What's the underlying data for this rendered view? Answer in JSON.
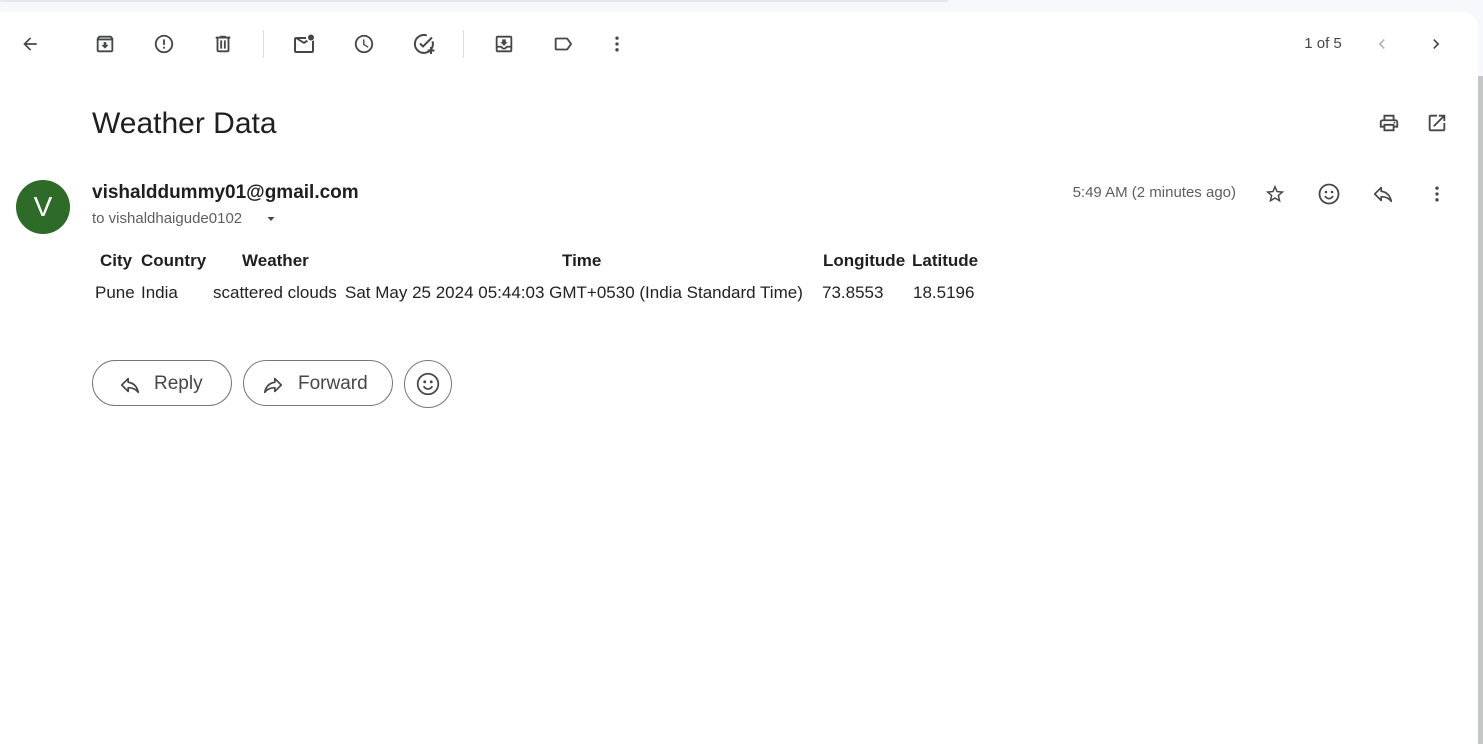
{
  "toolbar": {
    "counter": "1 of 5",
    "icons": {
      "back": "arrow-left-icon",
      "archive": "archive-icon",
      "spam": "report-spam-icon",
      "delete": "trash-icon",
      "mark_unread": "mark-unread-icon",
      "snooze": "clock-icon",
      "add_task": "add-task-icon",
      "move": "move-to-icon",
      "label": "label-icon",
      "more": "more-vertical-icon",
      "prev": "chevron-left-icon",
      "next": "chevron-right-icon"
    }
  },
  "message": {
    "subject": "Weather Data",
    "avatar_letter": "V",
    "avatar_color": "#2e6b28",
    "sender": "vishalddummy01@gmail.com",
    "to": "to vishaldhaigude0102",
    "time": "5:49 AM (2 minutes ago)"
  },
  "table": {
    "headers": [
      "City",
      "Country",
      "Weather",
      "Time",
      "Longitude",
      "Latitude"
    ],
    "rows": [
      [
        "Pune",
        "India",
        "scattered clouds",
        "Sat May 25 2024 05:44:03 GMT+0530 (India Standard Time)",
        "73.8553",
        "18.5196"
      ]
    ]
  },
  "actions": {
    "reply": "Reply",
    "forward": "Forward"
  }
}
